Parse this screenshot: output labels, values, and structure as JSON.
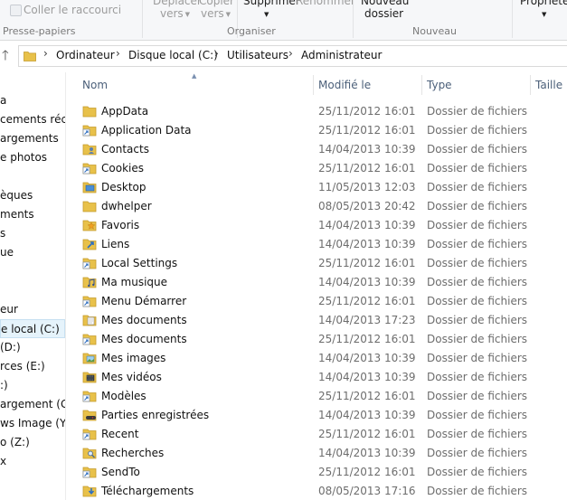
{
  "ribbon": {
    "paste_shortcut": "Coller le raccourci",
    "move_to_line1": "Déplacer",
    "move_to_line2": "vers",
    "copy_to_line1": "Copier",
    "copy_to_line2": "vers",
    "delete": "Supprimer",
    "rename": "Renommer",
    "new_folder_line1": "Nouveau",
    "new_folder_line2": "dossier",
    "properties": "Propriétés",
    "groups": {
      "clipboard": "Presse-papiers",
      "organize": "Organiser",
      "new": "Nouveau"
    }
  },
  "address": {
    "crumbs": [
      "Ordinateur",
      "Disque local (C:)",
      "Utilisateurs",
      "Administrateur"
    ]
  },
  "nav": {
    "items": [
      {
        "label": "a",
        "selected": false
      },
      {
        "label": "cements récen",
        "selected": false
      },
      {
        "label": "argements",
        "selected": false
      },
      {
        "label": "e photos",
        "selected": false
      },
      {
        "label": "",
        "selected": false
      },
      {
        "label": "èques",
        "selected": false
      },
      {
        "label": "ments",
        "selected": false
      },
      {
        "label": "s",
        "selected": false
      },
      {
        "label": "ue",
        "selected": false
      },
      {
        "label": "",
        "selected": false
      },
      {
        "label": "",
        "selected": false
      },
      {
        "label": "eur",
        "selected": false
      },
      {
        "label": "e local (C:)",
        "selected": true
      },
      {
        "label": "(D:)",
        "selected": false
      },
      {
        "label": "rces (E:)",
        "selected": false
      },
      {
        "label": ":)",
        "selected": false
      },
      {
        "label": "argement (G:)",
        "selected": false
      },
      {
        "label": "ws Image (Y:)",
        "selected": false
      },
      {
        "label": "o (Z:)",
        "selected": false
      },
      {
        "label": "x",
        "selected": false
      }
    ]
  },
  "columns": {
    "name": "Nom",
    "modified": "Modifié le",
    "type": "Type",
    "size": "Taille"
  },
  "files": [
    {
      "name": "AppData",
      "date": "25/11/2012 16:01",
      "type": "Dossier de fichiers",
      "icon": "folder-icon"
    },
    {
      "name": "Application Data",
      "date": "25/11/2012 16:01",
      "type": "Dossier de fichiers",
      "icon": "shortcut-folder-icon"
    },
    {
      "name": "Contacts",
      "date": "14/04/2013 10:39",
      "type": "Dossier de fichiers",
      "icon": "contacts-folder-icon"
    },
    {
      "name": "Cookies",
      "date": "25/11/2012 16:01",
      "type": "Dossier de fichiers",
      "icon": "shortcut-folder-icon"
    },
    {
      "name": "Desktop",
      "date": "11/05/2013 12:03",
      "type": "Dossier de fichiers",
      "icon": "desktop-folder-icon"
    },
    {
      "name": "dwhelper",
      "date": "08/05/2013 20:42",
      "type": "Dossier de fichiers",
      "icon": "folder-icon"
    },
    {
      "name": "Favoris",
      "date": "14/04/2013 10:39",
      "type": "Dossier de fichiers",
      "icon": "favorites-folder-icon"
    },
    {
      "name": "Liens",
      "date": "14/04/2013 10:39",
      "type": "Dossier de fichiers",
      "icon": "links-folder-icon"
    },
    {
      "name": "Local Settings",
      "date": "25/11/2012 16:01",
      "type": "Dossier de fichiers",
      "icon": "shortcut-folder-icon"
    },
    {
      "name": "Ma musique",
      "date": "14/04/2013 10:39",
      "type": "Dossier de fichiers",
      "icon": "music-folder-icon"
    },
    {
      "name": "Menu Démarrer",
      "date": "25/11/2012 16:01",
      "type": "Dossier de fichiers",
      "icon": "shortcut-folder-icon"
    },
    {
      "name": "Mes documents",
      "date": "14/04/2013 17:23",
      "type": "Dossier de fichiers",
      "icon": "documents-folder-icon"
    },
    {
      "name": "Mes documents",
      "date": "25/11/2012 16:01",
      "type": "Dossier de fichiers",
      "icon": "shortcut-folder-icon"
    },
    {
      "name": "Mes images",
      "date": "14/04/2013 10:39",
      "type": "Dossier de fichiers",
      "icon": "pictures-folder-icon"
    },
    {
      "name": "Mes vidéos",
      "date": "14/04/2013 10:39",
      "type": "Dossier de fichiers",
      "icon": "videos-folder-icon"
    },
    {
      "name": "Modèles",
      "date": "25/11/2012 16:01",
      "type": "Dossier de fichiers",
      "icon": "shortcut-folder-icon"
    },
    {
      "name": "Parties enregistrées",
      "date": "14/04/2013 10:39",
      "type": "Dossier de fichiers",
      "icon": "saved-games-folder-icon"
    },
    {
      "name": "Recent",
      "date": "25/11/2012 16:01",
      "type": "Dossier de fichiers",
      "icon": "shortcut-folder-icon"
    },
    {
      "name": "Recherches",
      "date": "14/04/2013 10:39",
      "type": "Dossier de fichiers",
      "icon": "searches-folder-icon"
    },
    {
      "name": "SendTo",
      "date": "25/11/2012 16:01",
      "type": "Dossier de fichiers",
      "icon": "shortcut-folder-icon"
    },
    {
      "name": "Téléchargements",
      "date": "08/05/2013 17:16",
      "type": "Dossier de fichiers",
      "icon": "downloads-folder-icon"
    }
  ],
  "colors": {
    "folder_yellow": "#e8c14a",
    "header_text": "#4c607a",
    "selection_bg": "#e5f3fb"
  }
}
